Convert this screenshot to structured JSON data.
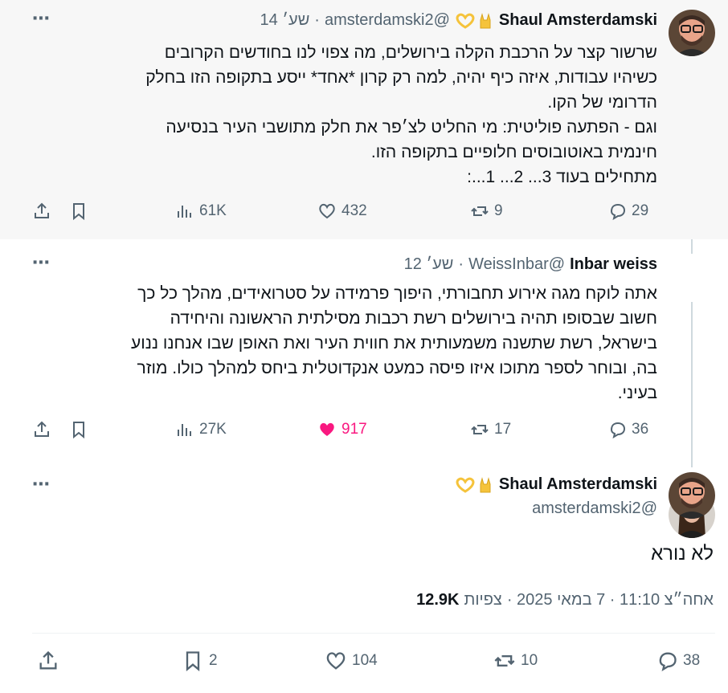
{
  "tweets": [
    {
      "name": "Shaul Amsterdamski",
      "handle": "@amsterdamski2",
      "time": "שע׳ 14",
      "text_lines": [
        "שרשור קצר על הרכבת הקלה בירושלים, מה צפוי לנו בחודשים הקרובים",
        "כשיהיו עבודות, איזה כיף יהיה, למה רק קרון *אחד* ייסע בתקופה הזו בחלק",
        "הדרומי של הקו.",
        "וגם - הפתעה פוליטית: מי החליט לצ׳פר את חלק מתושבי העיר בנסיעה",
        "חינמית באוטובוסים חלופיים בתקופה הזו.",
        "מתחילים בעוד 3... 2... 1...:"
      ],
      "replies": "29",
      "retweets": "9",
      "likes": "432",
      "views": "61K"
    },
    {
      "name": "Inbar weiss",
      "handle": "@WeissInbar",
      "time": "שע׳ 12",
      "text_lines": [
        "אתה לוקח מגה אירוע תחבורתי, היפוך פרמידה על סטרואידים, מהלך כל כך",
        "חשוב שבסופו תהיה בירושלים רשת רכבות מסילתית הראשונה והיחידה",
        "בישראל, רשת שתשנה משמעותית את חווית העיר ואת האופן שבו אנחנו ננוע",
        "בה, ובוחר לספר מתוכו איזו פיסה כמעט אנקדוטלית ביחס למהלך כולו. מוזר",
        "בעיני."
      ],
      "replies": "36",
      "retweets": "17",
      "likes": "917",
      "views": "27K"
    }
  ],
  "main": {
    "name": "Shaul Amsterdamski",
    "handle": "@amsterdamski2",
    "text": "לא נורא",
    "timestamp": "אחה״צ 11:10 · 7 במאי 2025 ·",
    "views_count": "12.9K",
    "views_label": "צפיות",
    "replies": "38",
    "retweets": "10",
    "likes": "104",
    "bookmarks": "2"
  },
  "icons": {
    "more": "more-icon",
    "reply": "reply-icon",
    "retweet": "retweet-icon",
    "like": "heart-icon",
    "views": "views-icon",
    "bookmark": "bookmark-icon",
    "share": "share-icon"
  },
  "colors": {
    "like_active": "#f91880",
    "muted": "#536471",
    "thread_line": "#cfd9de"
  }
}
